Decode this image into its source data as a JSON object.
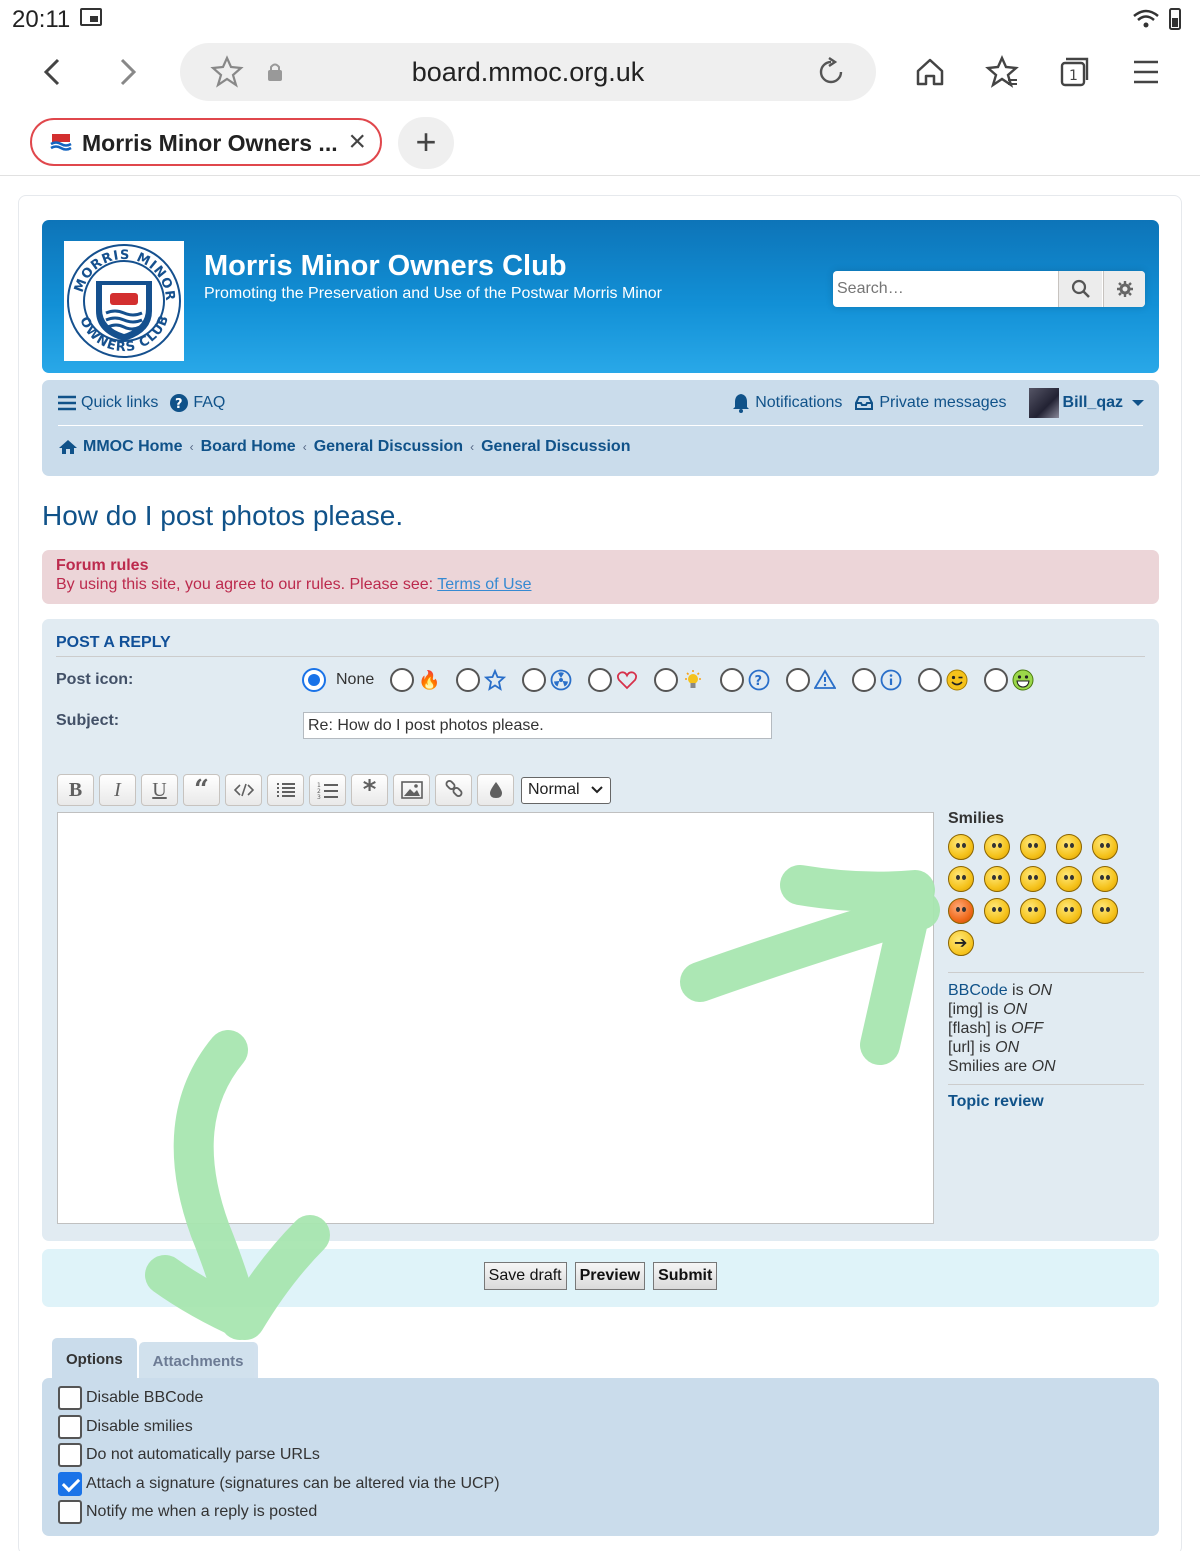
{
  "status_bar": {
    "time": "20:11"
  },
  "browser": {
    "url": "board.mmoc.org.uk",
    "tab_title": "Morris Minor Owners ...",
    "new_tab_label": "+"
  },
  "header": {
    "site_title": "Morris Minor Owners Club",
    "site_description": "Promoting the Preservation and Use of the Postwar Morris Minor",
    "search_placeholder": "Search…",
    "logo_text": {
      "top": "MORRIS MINOR",
      "bottom": "OWNERS CLUB"
    }
  },
  "navbar": {
    "quick_links": "Quick links",
    "faq": "FAQ",
    "notifications": "Notifications",
    "private_messages": "Private messages",
    "username": "Bill_qaz",
    "breadcrumbs": [
      "MMOC Home",
      "Board Home",
      "General Discussion",
      "General Discussion"
    ]
  },
  "topic_title": "How do I post photos please.",
  "forum_rules": {
    "heading": "Forum rules",
    "text": "By using this site, you agree to our rules. Please see: ",
    "link": "Terms of Use"
  },
  "post_form": {
    "heading": "POST A REPLY",
    "post_icon_label": "Post icon:",
    "post_icon_none": "None",
    "post_icons": [
      "fire-icon",
      "star-icon",
      "radioactive-icon",
      "heart-icon",
      "idea-icon",
      "question-icon",
      "warning-icon",
      "info-icon",
      "wink-icon",
      "grin-icon"
    ],
    "subject_label": "Subject:",
    "subject_value": "Re: How do I post photos please.",
    "font_size_option": "Normal",
    "bbcode_buttons": [
      "bold",
      "italic",
      "underline",
      "quote",
      "code",
      "list",
      "numbered-list",
      "list-item",
      "image",
      "url",
      "color"
    ]
  },
  "smilies_panel": {
    "heading": "Smilies",
    "count": 16,
    "bbcode_link": "BBCode",
    "bbcode_status": "ON",
    "img_label": "[img] is",
    "img_status": "ON",
    "flash_label": "[flash] is",
    "flash_status": "OFF",
    "url_label": "[url] is",
    "url_status": "ON",
    "smilies_label": "Smilies are",
    "smilies_status": "ON",
    "topic_review": "Topic review"
  },
  "buttons": {
    "save_draft": "Save draft",
    "preview": "Preview",
    "submit": "Submit"
  },
  "tabs": {
    "options": "Options",
    "attachments": "Attachments"
  },
  "options": [
    {
      "label": "Disable BBCode",
      "checked": false
    },
    {
      "label": "Disable smilies",
      "checked": false
    },
    {
      "label": "Do not automatically parse URLs",
      "checked": false
    },
    {
      "label": "Attach a signature (signatures can be altered via the UCP)",
      "checked": true
    },
    {
      "label": "Notify me when a reply is posted",
      "checked": false
    }
  ],
  "colors": {
    "header_blue": "#1290d6",
    "nav_bg": "#cadceb",
    "link_blue": "#105289",
    "rules_bg": "#ecd5d8",
    "annotation_green": "#a8e6b0"
  }
}
